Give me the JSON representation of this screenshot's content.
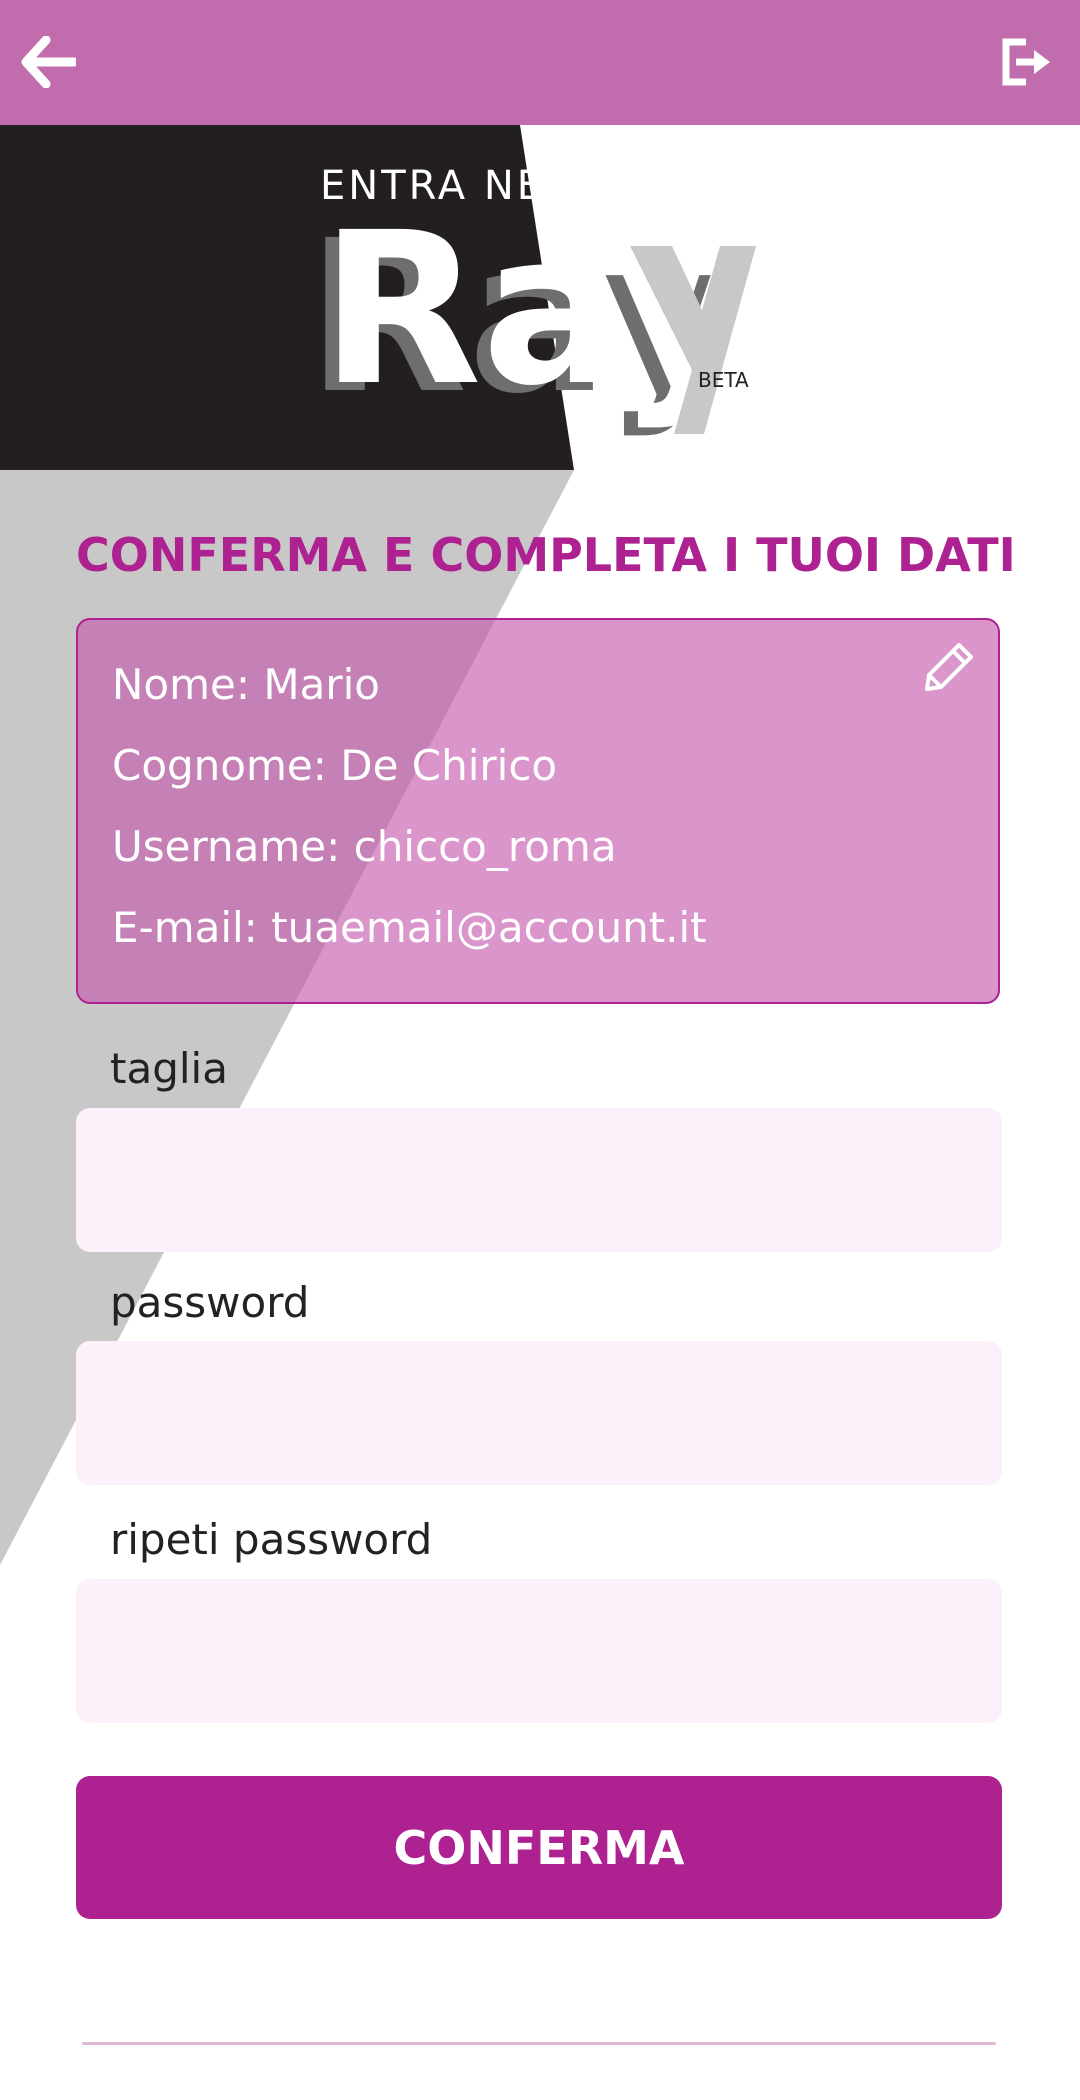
{
  "colors": {
    "app_bar": "#c16dad",
    "accent": "#ad2190",
    "card_fill": "#c454aa",
    "input_fill": "#fcf0fa",
    "logo_dark_panel": "#231f20",
    "logo_grey_panel": "#c9c8c9"
  },
  "header": {
    "back_icon": "arrow-left-icon",
    "logout_icon": "logout-icon"
  },
  "logo": {
    "tagline": "ENTRA NELLE STORIE",
    "wordmark": "Ray",
    "badge": "BETA"
  },
  "section_title": "CONFERMA E COMPLETA I TUOI DATI",
  "profile": {
    "edit_icon": "pencil-icon",
    "nome": "Nome: Mario",
    "cognome": "Cognome: De Chirico",
    "username": "Username: chicco_roma",
    "email": "E-mail: tuaemail@account.it"
  },
  "fields": {
    "taglia": {
      "label": "taglia",
      "value": ""
    },
    "password": {
      "label": "password",
      "value": ""
    },
    "ripeti_password": {
      "label": "ripeti password",
      "value": ""
    }
  },
  "confirm_button": "CONFERMA"
}
